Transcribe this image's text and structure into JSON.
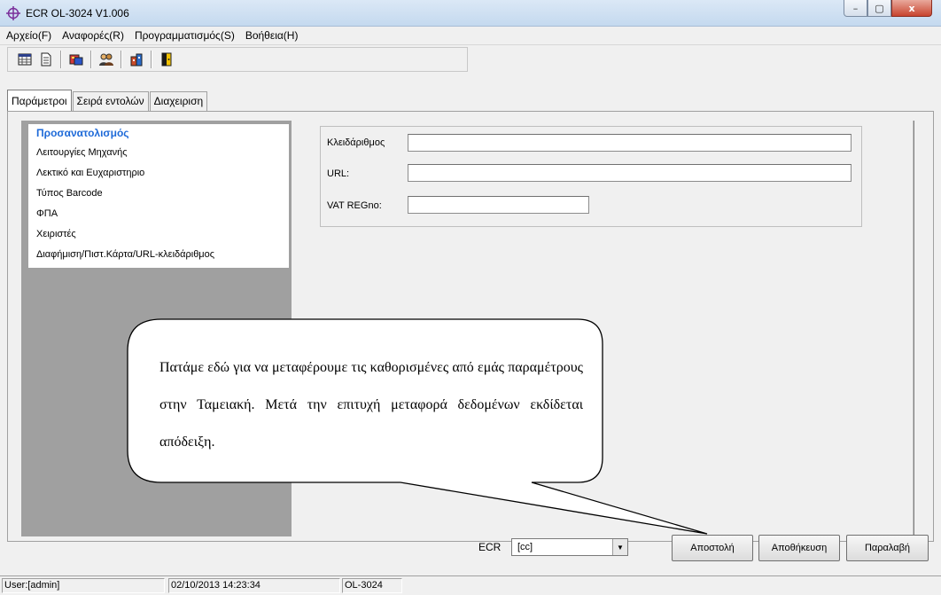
{
  "window": {
    "title": "ECR OL-3024 V1.006",
    "icon": "crosshair-app-icon",
    "controls": {
      "minimize": "–",
      "maximize": "▢",
      "close": "x"
    }
  },
  "menu": [
    {
      "label": "Αρχείο(F)"
    },
    {
      "label": "Αναφορές(R)"
    },
    {
      "label": "Προγραμματισμός(S)"
    },
    {
      "label": "Βοήθεια(H)"
    }
  ],
  "toolbar": {
    "icons": [
      "spreadsheet-icon",
      "document-icon",
      "card-reader-icon",
      "users-icon",
      "building-icon",
      "exit-door-icon"
    ]
  },
  "tabs": [
    {
      "label": "Παράμετροι",
      "active": true
    },
    {
      "label": "Σειρά εντολών",
      "active": false
    },
    {
      "label": "Διαχειριση",
      "active": false
    }
  ],
  "nav": {
    "heading": "Προσανατολισμός",
    "items": [
      "Λειτουργίες Μηχανής",
      "Λεκτικό και Ευχαριστηριο",
      "Τύπος Barcode",
      "ΦΠΑ",
      "Χειριστές",
      "Διαφήμιση/Πιστ.Κάρτα/URL-κλειδάριθμος"
    ]
  },
  "form": {
    "key_label": "Κλειδάριθμος",
    "key_value": "",
    "url_label": "URL:",
    "url_value": "",
    "vat_label": "VAT REGno:",
    "vat_value": ""
  },
  "callout": {
    "text": "Πατάμε εδώ για να μεταφέρουμε τις καθορισμένες από εμάς παραμέτρους στην Ταμειακή. Μετά την επιτυχή μεταφορά δεδομένων εκδίδεται απόδειξη."
  },
  "bottom": {
    "ecr_label": "ECR",
    "ecr_value": "[cc]",
    "send_label": "Αποστολή",
    "save_label": "Αποθήκευση",
    "receive_label": "Παραλαβή"
  },
  "status": {
    "user": "User:[admin]",
    "datetime": "02/10/2013 14:23:34",
    "model": "OL-3024"
  },
  "colors": {
    "accent_heading": "#1e6ad8",
    "nav_background": "#a0a0a0",
    "close_button": "#c8442f"
  }
}
